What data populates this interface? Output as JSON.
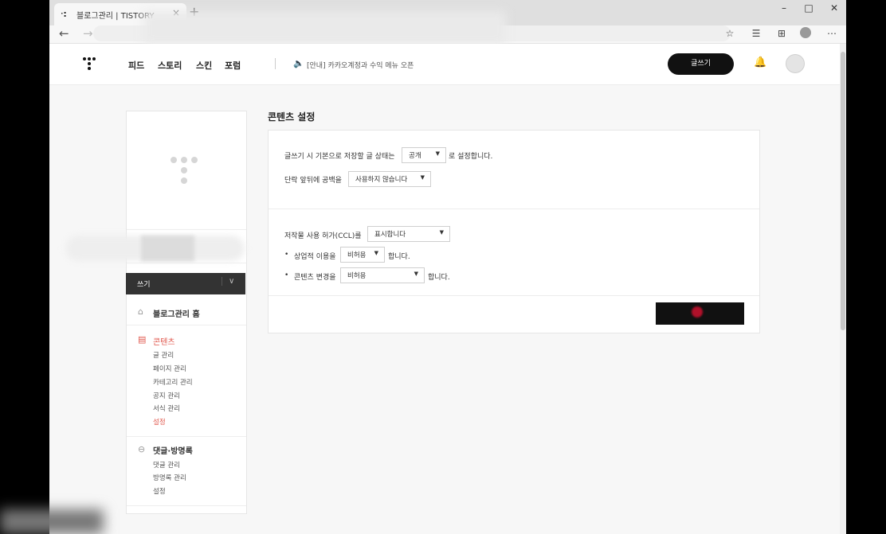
{
  "browser": {
    "tab_title": "블로그관리 | TISTORY",
    "tab_close": "×",
    "new_tab": "+",
    "window_min": "–",
    "window_max": "□",
    "window_close": "✕"
  },
  "gnb": {
    "menu": [
      "피드",
      "스토리",
      "스킨",
      "포럼"
    ],
    "notice": "[안내] 카카오계정과 수익 메뉴 오픈",
    "write_button": "글쓰기"
  },
  "sidebar": {
    "write_label": "쓰기",
    "home": "블로그관리 홈",
    "sections": [
      {
        "title": "콘텐츠",
        "items": [
          "글 관리",
          "페이지 관리",
          "카테고리 관리",
          "공지 관리",
          "서식 관리",
          "설정"
        ]
      },
      {
        "title": "댓글·방명록",
        "items": [
          "댓글 관리",
          "방명록 관리",
          "설정"
        ]
      }
    ]
  },
  "main": {
    "title": "콘텐츠 설정",
    "row1_prefix": "글쓰기 시 기본으로 저장할 글 상태는",
    "row1_value": "공개",
    "row1_suffix": "로 설정합니다.",
    "row2_prefix": "단락 앞뒤에 공백을",
    "row2_value": "사용하지 않습니다",
    "ccl_prefix": "저작물 사용 허가(CCL)를",
    "ccl_value": "표시합니다",
    "commercial_prefix": "상업적 이용을",
    "commercial_value": "비허용",
    "commercial_suffix": "합니다.",
    "modify_prefix": "콘텐츠 변경을",
    "modify_value": "비허용",
    "modify_suffix": "합니다."
  },
  "colors": {
    "accent": "#e0564b",
    "dark": "#111111"
  }
}
